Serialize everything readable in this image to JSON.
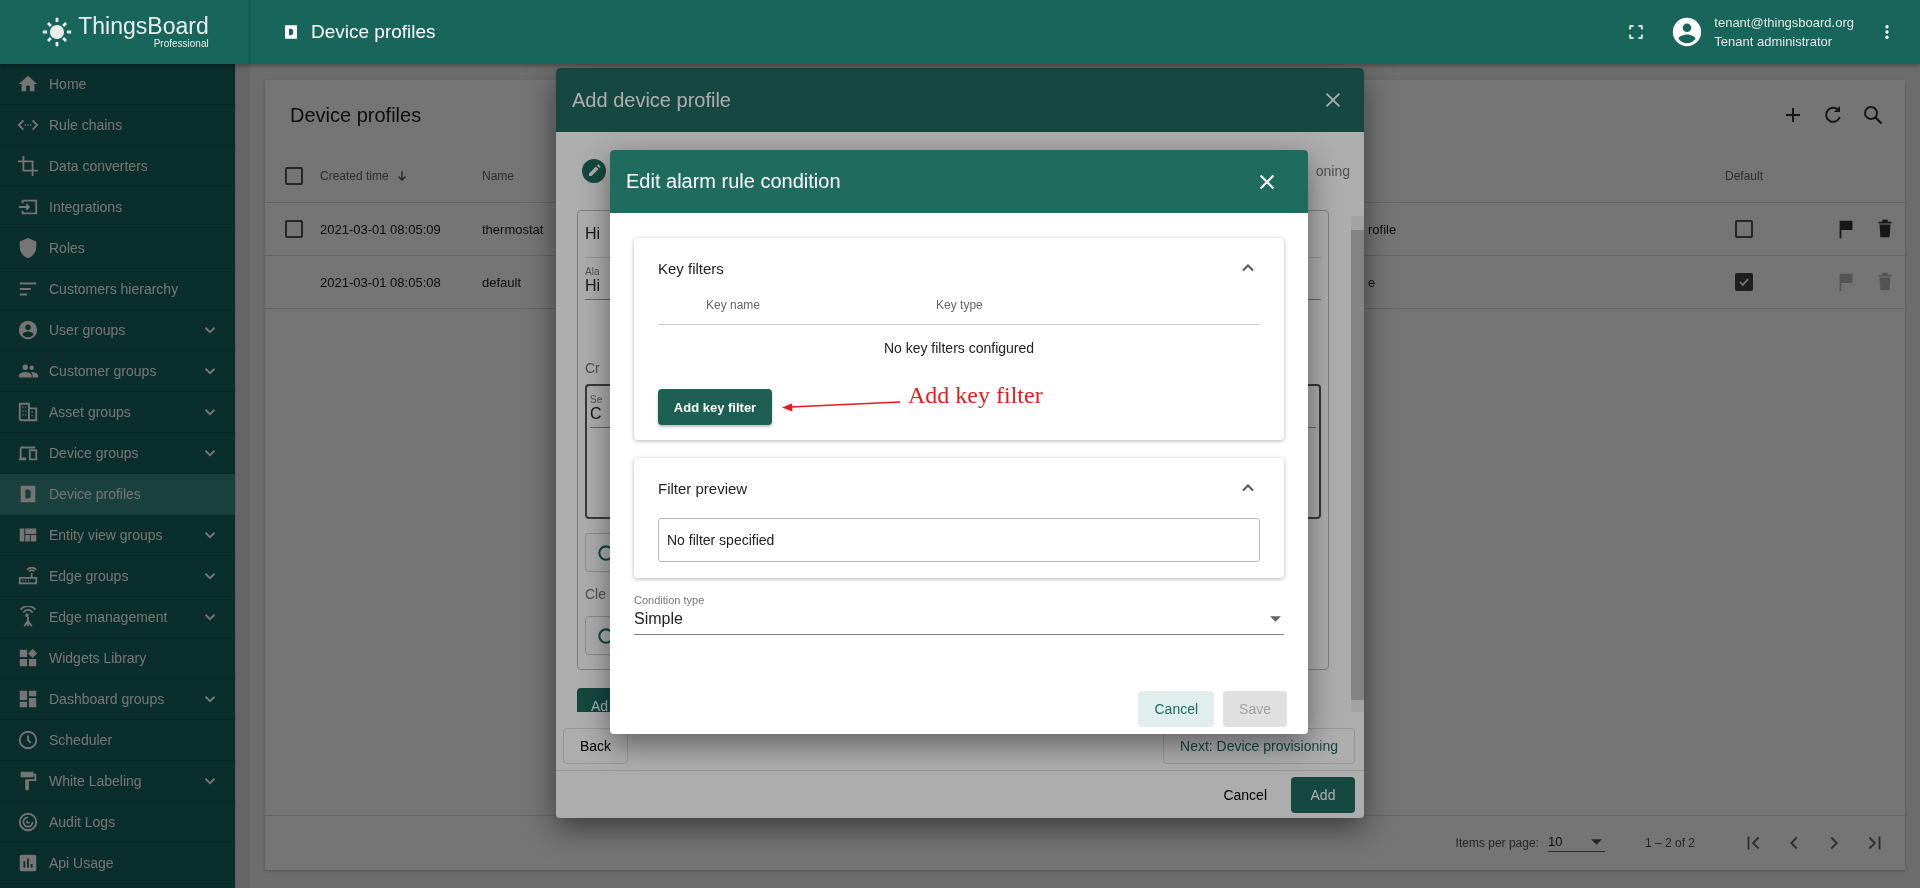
{
  "app": {
    "logo": "ThingsBoard",
    "edition": "Professional"
  },
  "topbar": {
    "title": "Device profiles",
    "user": {
      "email": "tenant@thingsboard.org",
      "role": "Tenant administrator"
    }
  },
  "sidebar": {
    "items": [
      {
        "label": "Home",
        "selected": false
      },
      {
        "label": "Rule chains",
        "selected": false
      },
      {
        "label": "Data converters",
        "selected": false
      },
      {
        "label": "Integrations",
        "selected": false
      },
      {
        "label": "Roles",
        "selected": false
      },
      {
        "label": "Customers hierarchy",
        "selected": false
      },
      {
        "label": "User groups",
        "selected": false,
        "expanded": false
      },
      {
        "label": "Customer groups",
        "selected": false,
        "expanded": false
      },
      {
        "label": "Asset groups",
        "selected": false,
        "expanded": false
      },
      {
        "label": "Device groups",
        "selected": false,
        "expanded": false
      },
      {
        "label": "Device profiles",
        "selected": true
      },
      {
        "label": "Entity view groups",
        "selected": false,
        "expanded": false
      },
      {
        "label": "Edge groups",
        "selected": false,
        "expanded": false
      },
      {
        "label": "Edge management",
        "selected": false,
        "expanded": false
      },
      {
        "label": "Widgets Library",
        "selected": false
      },
      {
        "label": "Dashboard groups",
        "selected": false,
        "expanded": false
      },
      {
        "label": "Scheduler",
        "selected": false
      },
      {
        "label": "White Labeling",
        "selected": false,
        "expanded": false
      },
      {
        "label": "Audit Logs",
        "selected": false
      },
      {
        "label": "Api Usage",
        "selected": false
      }
    ]
  },
  "table": {
    "title": "Device profiles",
    "all_selected": false,
    "columns": [
      {
        "label": "Created time",
        "sorted": true
      },
      {
        "label": "Name"
      },
      {
        "label": "Default"
      }
    ],
    "rows": [
      {
        "selectable": true,
        "selected": false,
        "created_time": "2021-03-01 08:05:09",
        "name": "thermostat",
        "column_3": "rofile",
        "default": false,
        "actions_disabled": false
      },
      {
        "selectable": false,
        "selected": false,
        "created_time": "2021-03-01 08:05:08",
        "name": "default",
        "column_3": "e",
        "default": true,
        "actions_disabled": true
      }
    ]
  },
  "pagination": {
    "label": "Items per page:",
    "page_size": "10",
    "range": "1 – 2 of 2"
  },
  "add_dialog": {
    "title": "Add device profile",
    "step_label": "oning",
    "form": {
      "name_value": "Hi",
      "alarm_label": "Ala",
      "alarm_value": "Hi",
      "create_label": "Cr",
      "condition_label": "Se",
      "condition_value": "C",
      "clear_label": "Cle",
      "add_button": "Ad"
    },
    "back": "Back",
    "next": "Next: Device provisioning",
    "cancel": "Cancel",
    "add": "Add"
  },
  "edit_dialog": {
    "title": "Edit alarm rule condition",
    "key_filters": {
      "title": "Key filters",
      "expanded": true,
      "columns": [
        "Key name",
        "Key type"
      ],
      "empty_text": "No key filters configured",
      "add_button": "Add key filter"
    },
    "filter_preview": {
      "title": "Filter preview",
      "expanded": true,
      "value": "No filter specified"
    },
    "condition_type": {
      "label": "Condition type",
      "value": "Simple"
    },
    "buttons": [
      {
        "label": "Cancel",
        "kind": "secondary",
        "disabled": false
      },
      {
        "label": "Save",
        "kind": "primary",
        "disabled": true
      }
    ]
  },
  "annotation": {
    "text": "Add key filter"
  }
}
